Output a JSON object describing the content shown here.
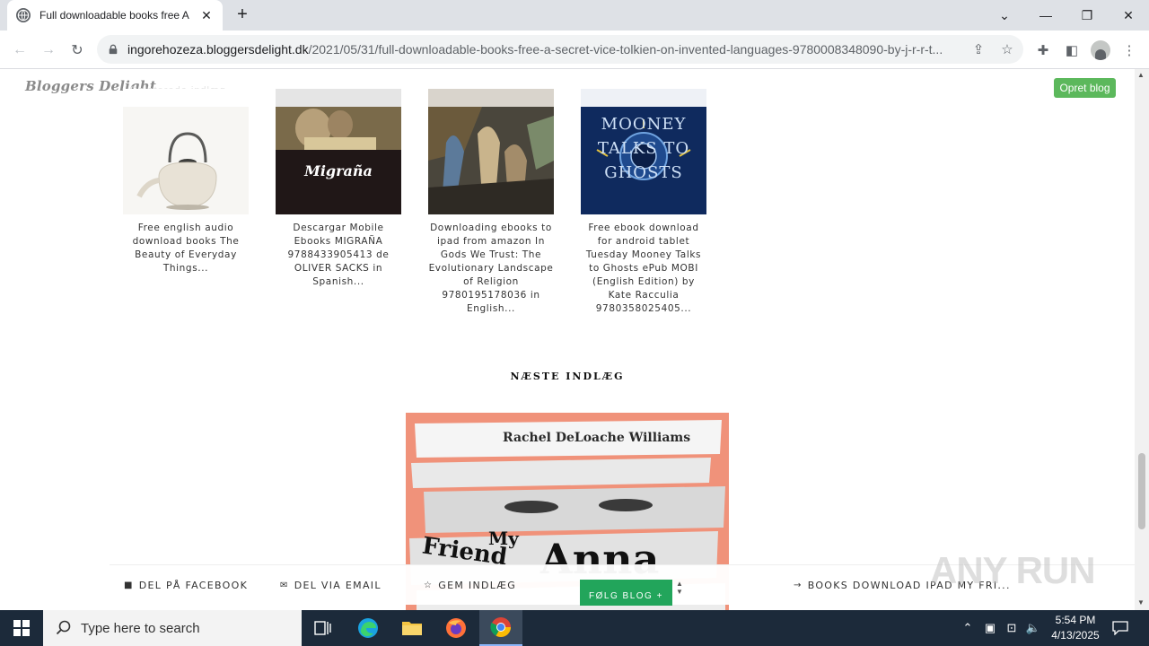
{
  "browser": {
    "tab_title": "Full downloadable books free A",
    "url_host": "ingorehozeza.bloggersdelight.dk",
    "url_path": "/2021/05/31/full-downloadable-books-free-a-secret-vice-tolkien-on-invented-languages-9780008348090-by-j-r-r-t..."
  },
  "site": {
    "logo": "Bloggers Delight",
    "create_blog": "Opret blog",
    "faded_heading": "Relaterede indlæg"
  },
  "related_posts": [
    {
      "caption": "Free english audio download books The Beauty of Everyday Things..."
    },
    {
      "caption": "Descargar Mobile Ebooks MIGRAÑA 9788433905413 de OLIVER SACKS in Spanish...",
      "cover_text": "Migraña"
    },
    {
      "caption": "Downloading ebooks to ipad from amazon In Gods We Trust: The Evolutionary Landscape of Religion 9780195178036 in English..."
    },
    {
      "caption": "Free ebook download for android tablet Tuesday Mooney Talks to Ghosts ePub MOBI (English Edition) by Kate Racculia 9780358025405...",
      "cover_text": "MOONEY TALKS TO GHOSTS"
    }
  ],
  "next_post": {
    "label": "NÆSTE INDLÆG",
    "cover_author": "Rachel DeLoache Williams",
    "cover_title_1": "My",
    "cover_title_2": "Friend",
    "cover_title_3": "Anna"
  },
  "sharebar": {
    "facebook": "DEL PÅ FACEBOOK",
    "email": "DEL VIA EMAIL",
    "save": "GEM INDLÆG",
    "follow": "FØLG BLOG +",
    "next_link": "BOOKS DOWNLOAD IPAD MY FRI..."
  },
  "watermark": "ANY RUN",
  "taskbar": {
    "search_placeholder": "Type here to search",
    "time": "5:54 PM",
    "date": "4/13/2025"
  }
}
